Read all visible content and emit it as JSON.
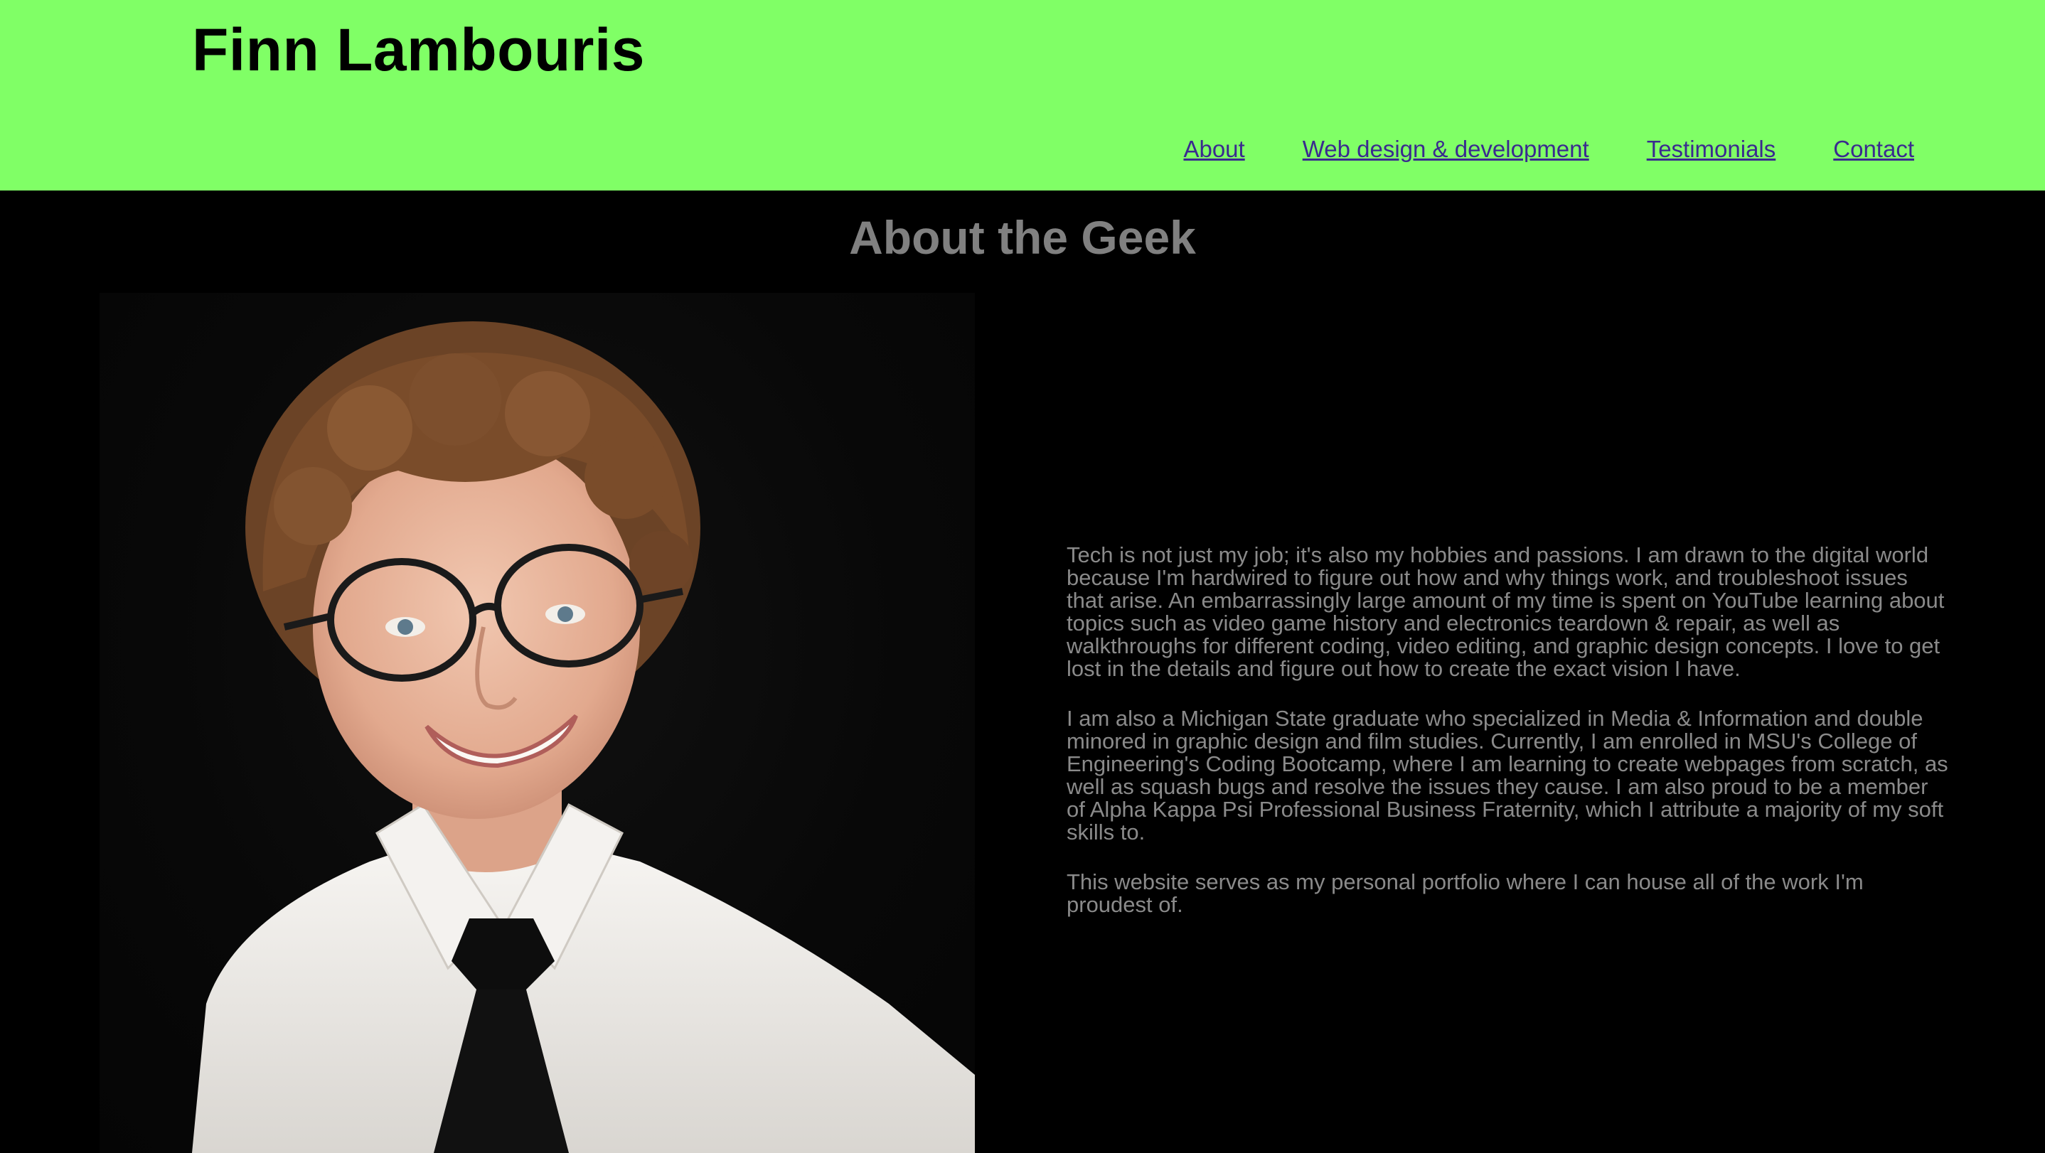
{
  "header": {
    "title": "Finn Lambouris",
    "background_color": "#80ff66"
  },
  "nav": {
    "items": [
      {
        "label": "About"
      },
      {
        "label": "Web design & development"
      },
      {
        "label": "Testimonials"
      },
      {
        "label": "Contact"
      }
    ],
    "link_color": "#3a2a8f"
  },
  "about": {
    "heading": "About the Geek",
    "paragraphs": [
      "Tech is not just my job; it's also my hobbies and passions. I am drawn to the digital world because I'm hardwired to figure out how and why things work, and troubleshoot issues that arise. An embarrassingly large amount of my time is spent on YouTube learning about topics such as video game history and electronics teardown & repair, as well as walkthroughs for different coding, video editing, and graphic design concepts. I love to get lost in the details and figure out how to create the exact vision I have.",
      "I am also a Michigan State graduate who specialized in Media & Information and double minored in graphic design and film studies. Currently, I am enrolled in MSU's College of Engineering's Coding Bootcamp, where I am learning to create webpages from scratch, as well as squash bugs and resolve the issues they cause. I am also proud to be a member of Alpha Kappa Psi Professional Business Fraternity, which I attribute a majority of my soft skills to.",
      "This website serves as my personal portfolio where I can house all of the work I'm proudest of."
    ],
    "text_color": "#8a8a8a",
    "photo_icon": "portrait-photo"
  }
}
